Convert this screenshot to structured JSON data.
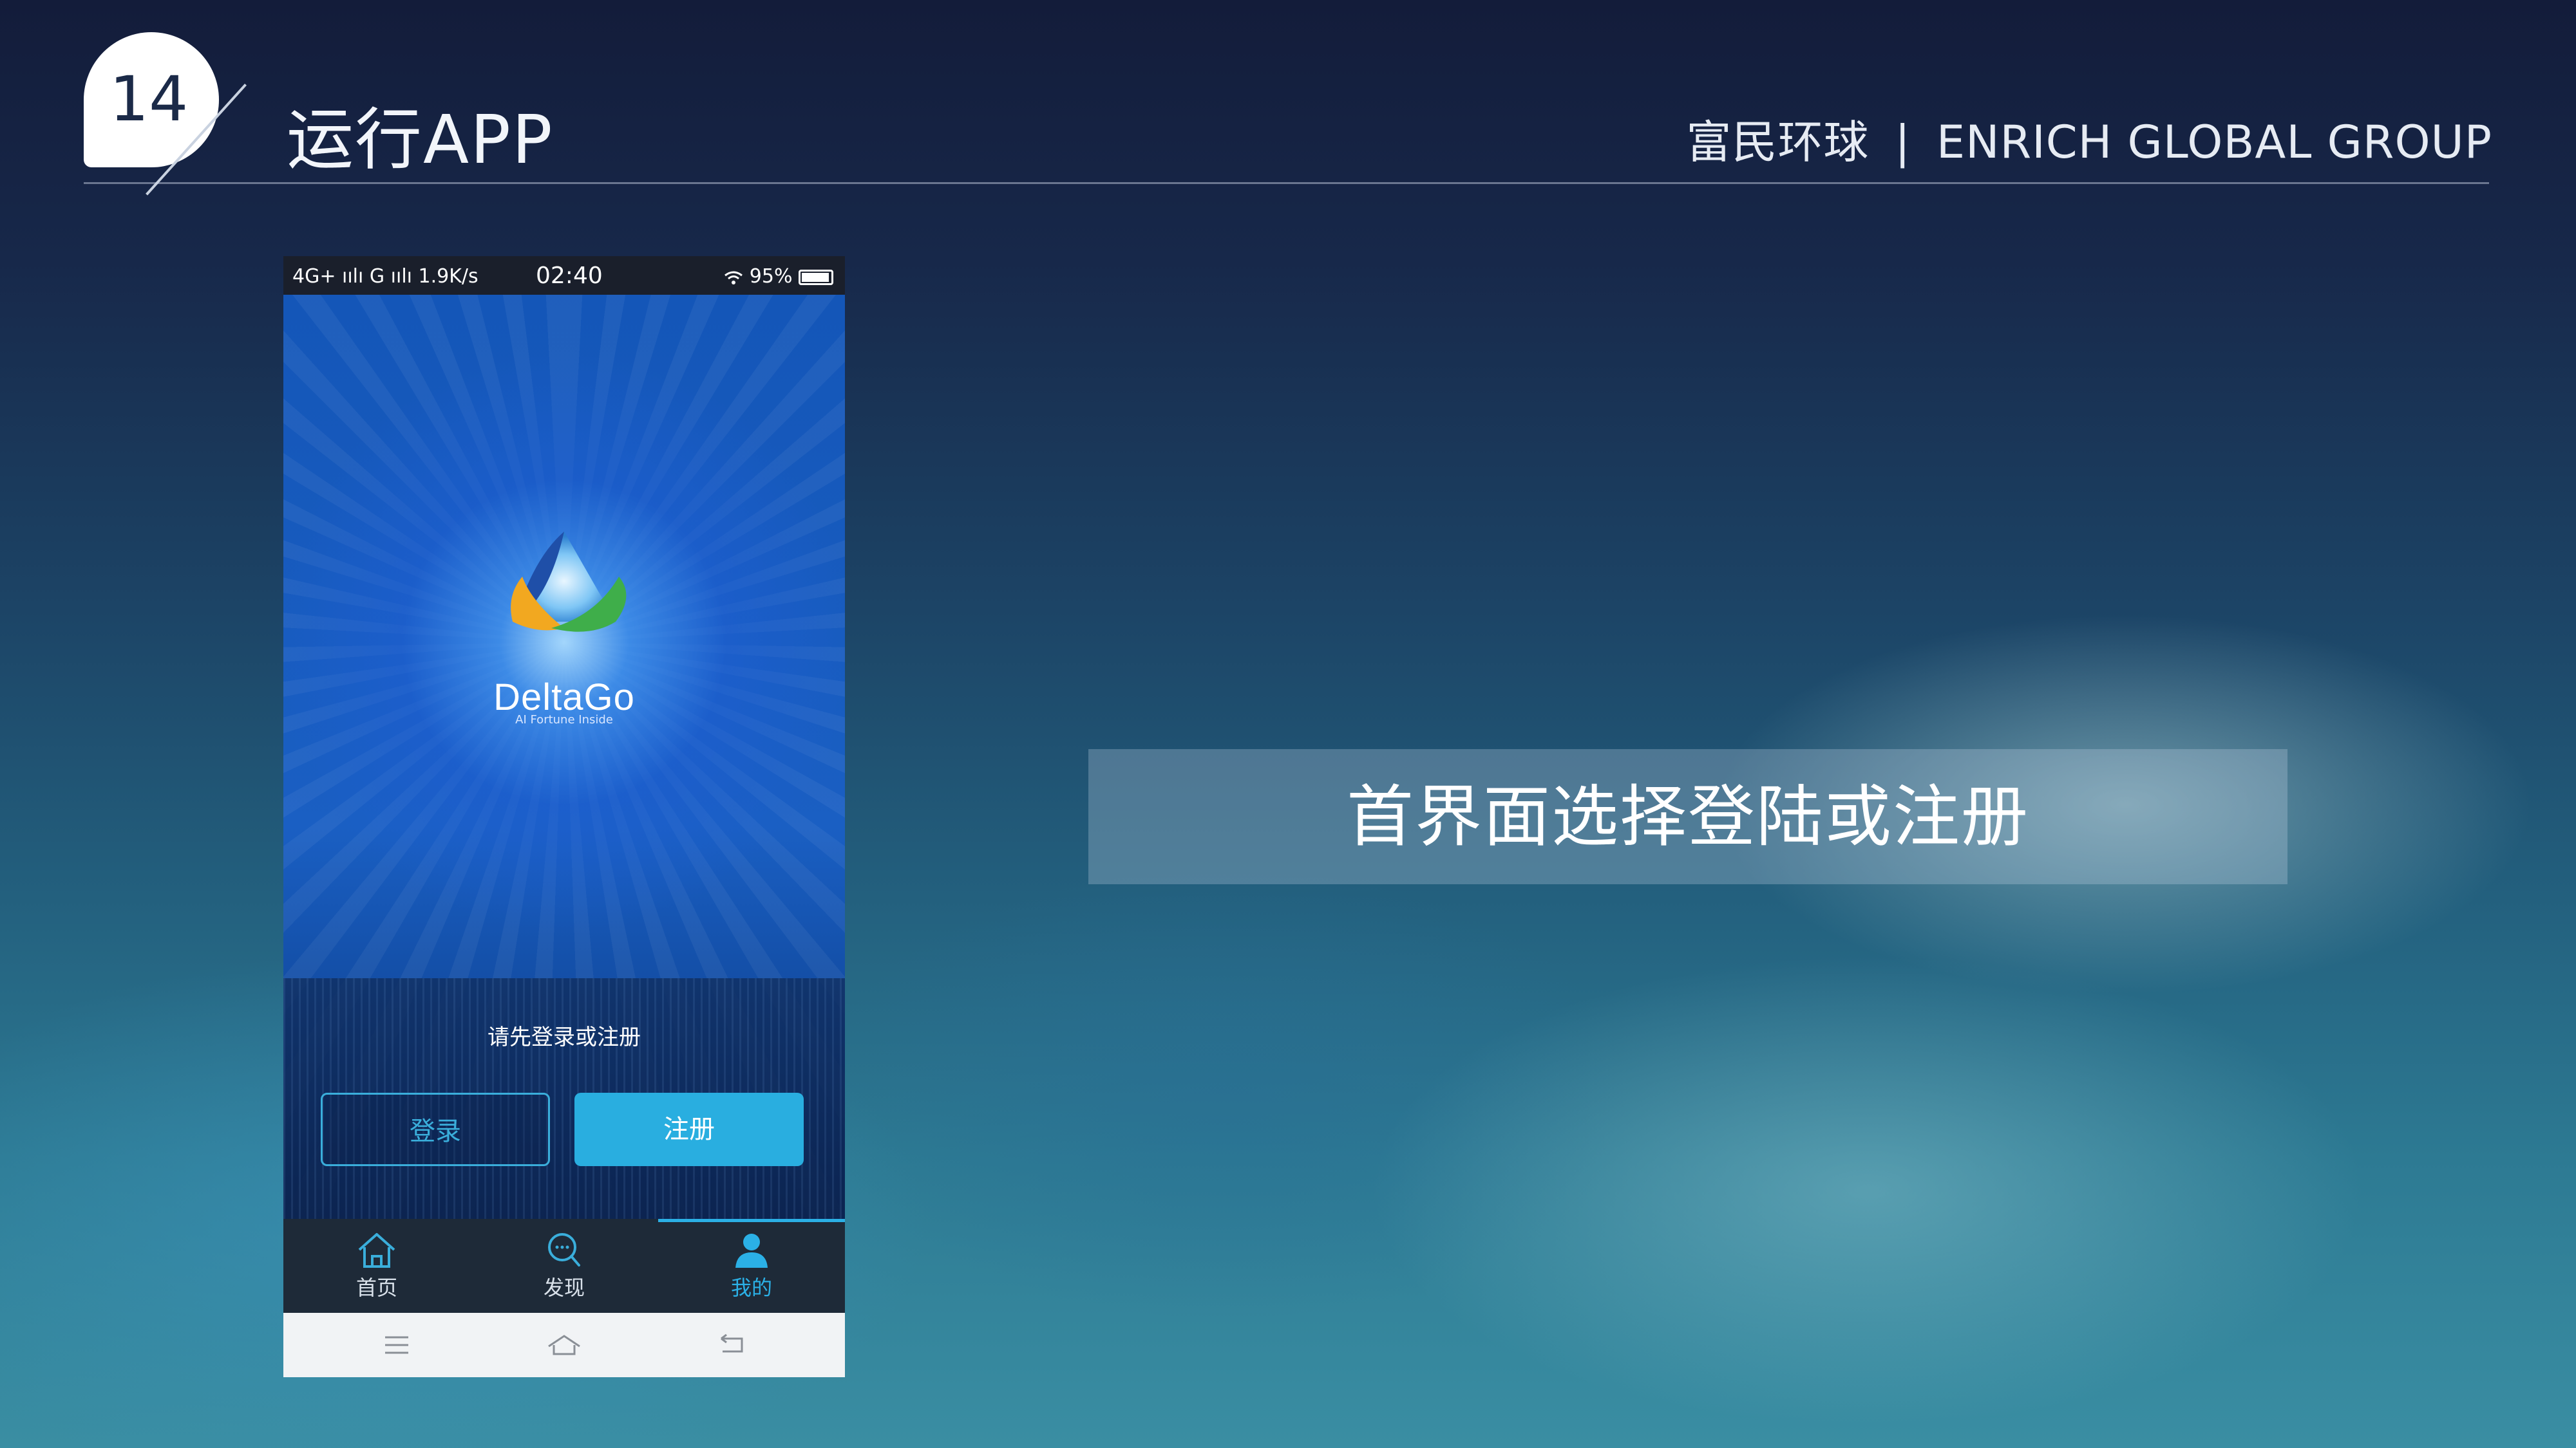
{
  "slide": {
    "number": "14",
    "title": "运行APP",
    "brand_cn": "富民环球",
    "brand_sep": "|",
    "brand_en": "ENRICH GLOBAL GROUP"
  },
  "phone": {
    "status": {
      "left": "4G+ ıılı G ıılı 1.9K/s",
      "time": "02:40",
      "battery": "95%"
    },
    "app": {
      "name": "DeltaGo",
      "tagline": "AI Fortune Inside",
      "prompt": "请先登录或注册",
      "login_label": "登录",
      "register_label": "注册"
    },
    "tabs": [
      {
        "label": "首页",
        "icon": "home-icon",
        "active": false
      },
      {
        "label": "发现",
        "icon": "discover-icon",
        "active": false
      },
      {
        "label": "我的",
        "icon": "user-icon",
        "active": true
      }
    ],
    "accent_color": "#2bb0e6"
  },
  "caption": "首界面选择登陆或注册"
}
